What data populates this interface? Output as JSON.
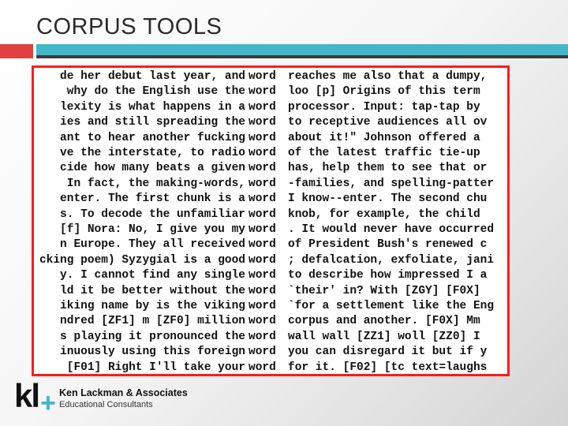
{
  "slide": {
    "title": "CORPUS TOOLS",
    "accent_colors": {
      "red": "#e04040",
      "teal": "#41b7c9",
      "border": "#ff1a1a"
    }
  },
  "concordance": {
    "keyword_lines": [
      {
        "left": "de her debut last year, and",
        "kw": "word",
        "right": "reaches me also that a dumpy,"
      },
      {
        "left": " why do the English use the",
        "kw": "word",
        "right": "loo [p] Origins of this term"
      },
      {
        "left": "lexity is what happens in a",
        "kw": "word",
        "right": "processor. Input: tap-tap by"
      },
      {
        "left": "ies and still spreading the",
        "kw": "word",
        "right": "to receptive audiences all ov"
      },
      {
        "left": "ant to hear another fucking",
        "kw": "word",
        "right": "about it!\" Johnson offered a"
      },
      {
        "left": "ve the interstate, to radio",
        "kw": "word",
        "right": "of the latest traffic tie-up"
      },
      {
        "left": "cide how many beats a given",
        "kw": "word",
        "right": "has, help them to see that or"
      },
      {
        "left": " In fact, the making-words,",
        "kw": "word",
        "right": "-families, and spelling-patter"
      },
      {
        "left": "enter. The first chunk is a",
        "kw": "word",
        "right": "I know--enter. The second chu"
      },
      {
        "left": "s. To decode the unfamiliar",
        "kw": "word",
        "right": "knob, for example, the child"
      },
      {
        "left": "[f] Nora: No, I give you my",
        "kw": "word",
        "right": ". It would never have occurred"
      },
      {
        "left": "n Europe. They all received",
        "kw": "word",
        "right": "of President Bush's renewed c"
      },
      {
        "left": "cking poem) Syzygial is a good",
        "kw": "word",
        "right": "; defalcation, exfoliate, jani"
      },
      {
        "left": "y. I cannot find any single",
        "kw": "word",
        "right": "to describe how impressed I a"
      },
      {
        "left": "ld it be better without the",
        "kw": "word",
        "right": "`their' in? With [ZGY] [F0X]"
      },
      {
        "left": "iking name by is the viking",
        "kw": "word",
        "right": "`for a settlement like the Eng"
      },
      {
        "left": "ndred [ZF1] m [ZF0] million",
        "kw": "word",
        "right": "corpus and another. [F0X] Mm"
      },
      {
        "left": "s playing it pronounced the",
        "kw": "word",
        "right": "wall wall [ZZ1] woll [ZZ0] I"
      },
      {
        "left": "inuously using this foreign",
        "kw": "word",
        "right": "you can disregard it but if y"
      },
      {
        "left": "[F01] Right I'll take your",
        "kw": "word",
        "right": "for it. [F02] [tc text=laughs"
      }
    ]
  },
  "footer": {
    "logo_text": "kl",
    "logo_plus": "+",
    "company": "Ken Lackman & Associates",
    "tagline": "Educational Consultants"
  }
}
